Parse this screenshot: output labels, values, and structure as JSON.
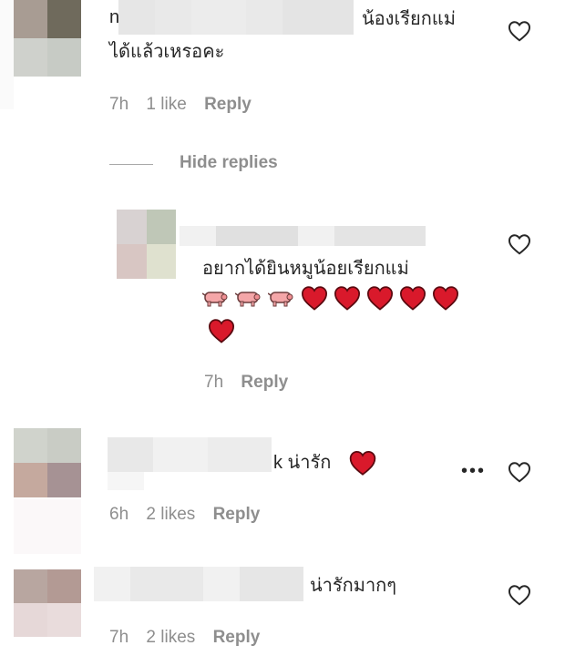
{
  "comments": [
    {
      "initial": "n",
      "text_line1": "น้องเรียกแม่",
      "text_line2": "ได้แล้วเหรอคะ",
      "time": "7h",
      "likes": "1 like",
      "reply_label": "Reply",
      "hide_replies_label": "Hide replies"
    },
    {
      "text": "อยากได้ยินหมูน้อยเรียกแม่",
      "emojis": [
        "pig-icon",
        "pig-icon",
        "pig-icon",
        "heart-emoji",
        "heart-emoji",
        "heart-emoji",
        "heart-emoji",
        "heart-emoji",
        "heart-emoji"
      ],
      "time": "7h",
      "reply_label": "Reply"
    },
    {
      "text": "k น่ารัก",
      "time": "6h",
      "likes": "2 likes",
      "reply_label": "Reply",
      "more_label": "•••"
    },
    {
      "text": "น่ารักมากๆ",
      "time": "7h",
      "likes": "2 likes",
      "reply_label": "Reply"
    }
  ],
  "colors": {
    "meta_text": "#8e8e8e",
    "body_text": "#262626",
    "heart_red": "#d9192b"
  }
}
